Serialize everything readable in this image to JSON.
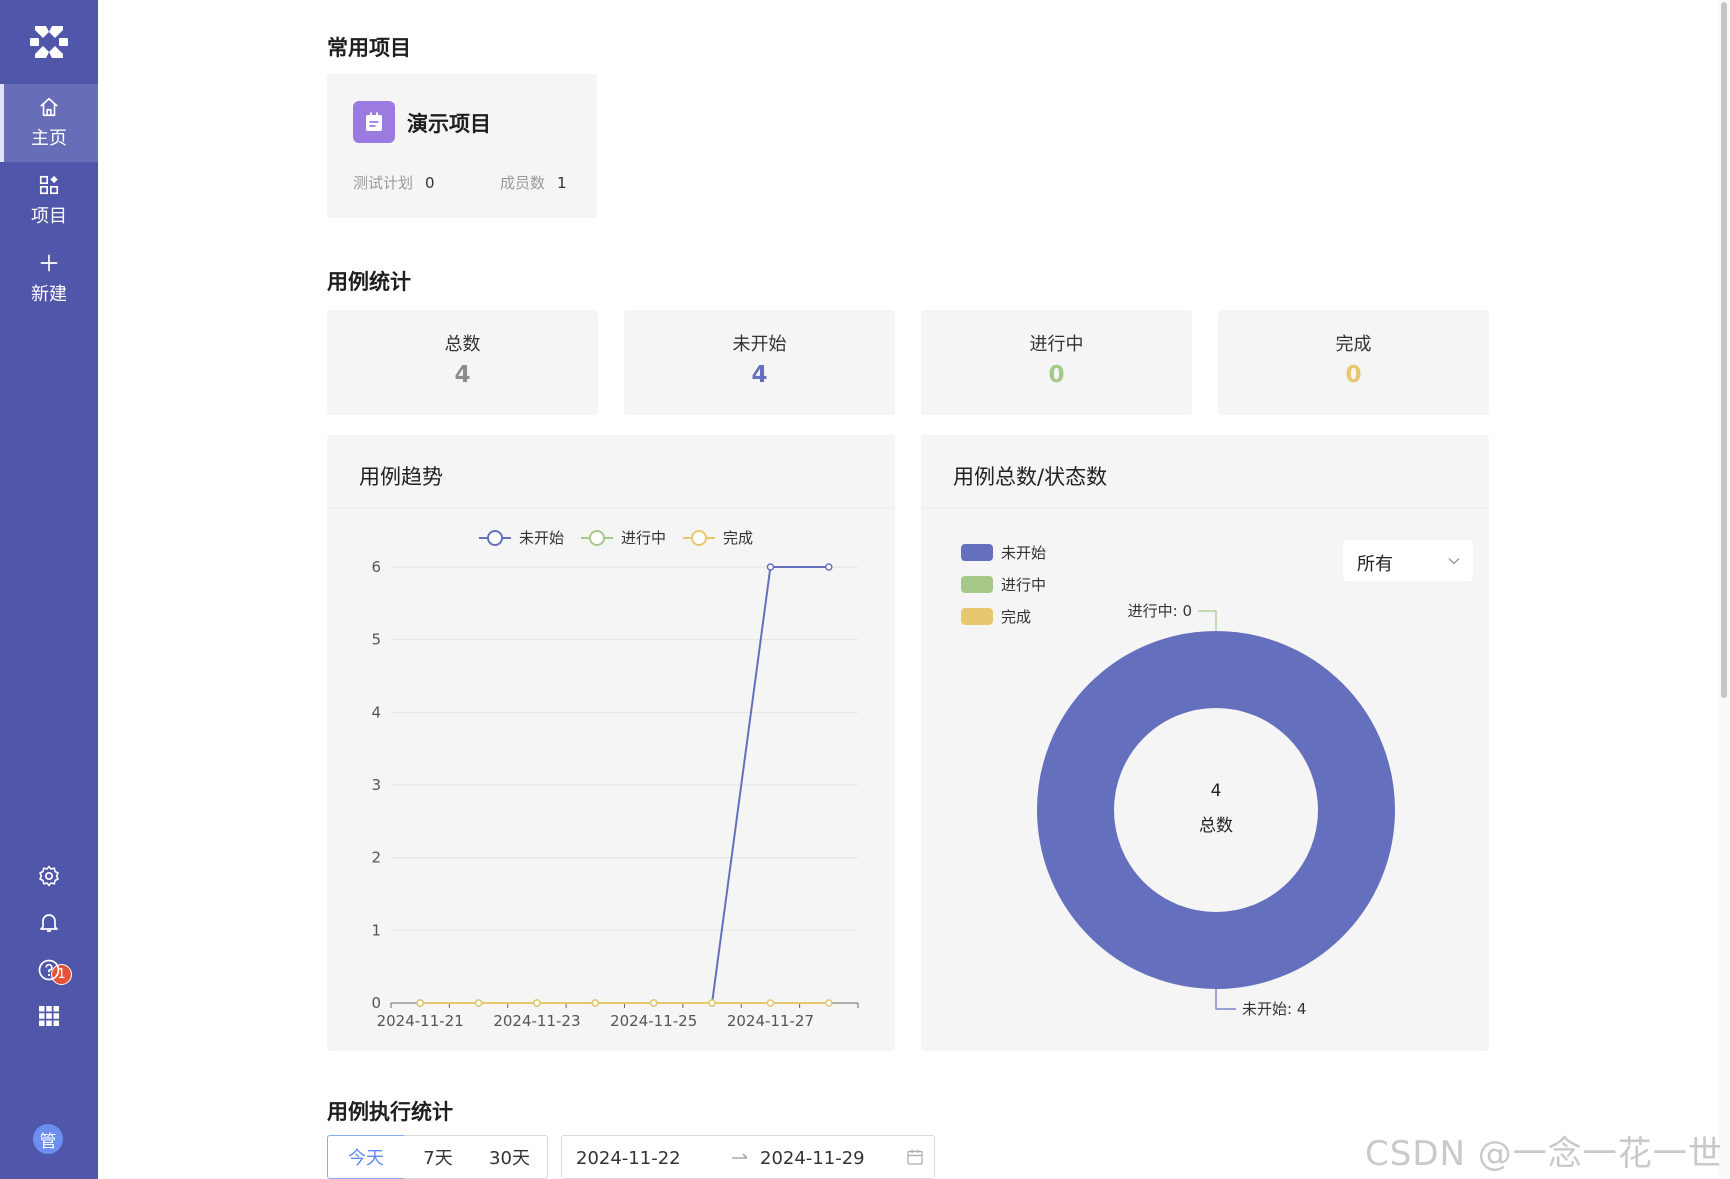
{
  "sidebar": {
    "nav": [
      {
        "label": "主页",
        "icon": "home-icon",
        "active": true
      },
      {
        "label": "项目",
        "icon": "apps-icon",
        "active": false
      },
      {
        "label": "新建",
        "icon": "plus-icon",
        "active": false
      }
    ],
    "notification_count": "1",
    "avatar_text": "管"
  },
  "favorites": {
    "title": "常用项目",
    "project": {
      "name": "演示项目",
      "plans_label": "测试计划",
      "plans_value": "0",
      "members_label": "成员数",
      "members_value": "1"
    }
  },
  "case_stats": {
    "title": "用例统计",
    "cards": [
      {
        "label": "总数",
        "value": "4",
        "color": "#8c8c8c"
      },
      {
        "label": "未开始",
        "value": "4",
        "color": "#6470bd"
      },
      {
        "label": "进行中",
        "value": "0",
        "color": "#a6c98a"
      },
      {
        "label": "完成",
        "value": "0",
        "color": "#e8c86e"
      }
    ]
  },
  "trend_panel": {
    "title": "用例趋势"
  },
  "status_panel": {
    "title": "用例总数/状态数",
    "filter_value": "所有"
  },
  "colors": {
    "sidebar": "#5056a9",
    "not_started": "#6470bd",
    "in_progress": "#a6c98a",
    "done": "#e8c86e",
    "active_tab": "#5f8bf0"
  },
  "chart_data": [
    {
      "type": "line",
      "title": "用例趋势",
      "x": [
        "2024-11-21",
        "2024-11-22",
        "2024-11-23",
        "2024-11-24",
        "2024-11-25",
        "2024-11-26",
        "2024-11-27",
        "2024-11-28"
      ],
      "x_tick_labels": [
        "2024-11-21",
        "2024-11-23",
        "2024-11-25",
        "2024-11-27"
      ],
      "ylim": [
        0,
        6
      ],
      "y_ticks": [
        0,
        1,
        2,
        3,
        4,
        5,
        6
      ],
      "grid": true,
      "legend": "top-center",
      "series": [
        {
          "name": "未开始",
          "color": "#6470bd",
          "values": [
            0,
            0,
            0,
            0,
            0,
            0,
            6,
            6
          ]
        },
        {
          "name": "进行中",
          "color": "#a6c98a",
          "values": [
            0,
            0,
            0,
            0,
            0,
            0,
            0,
            0
          ]
        },
        {
          "name": "完成",
          "color": "#e8c86e",
          "values": [
            0,
            0,
            0,
            0,
            0,
            0,
            0,
            0
          ]
        }
      ]
    },
    {
      "type": "pie",
      "title": "用例总数/状态数",
      "legend": "top-left",
      "center_value": "4",
      "center_label": "总数",
      "slices": [
        {
          "name": "未开始",
          "value": 4,
          "color": "#6470bd",
          "label": "未开始: 4"
        },
        {
          "name": "进行中",
          "value": 0,
          "color": "#a6c98a",
          "label": "进行中: 0"
        },
        {
          "name": "完成",
          "value": 0,
          "color": "#e8c86e",
          "label": ""
        }
      ]
    }
  ],
  "execution": {
    "title": "用例执行统计",
    "tabs": [
      "今天",
      "7天",
      "30天"
    ],
    "start_date": "2024-11-22",
    "end_date": "2024-11-29"
  },
  "watermark": "CSDN @一念一花一世界"
}
